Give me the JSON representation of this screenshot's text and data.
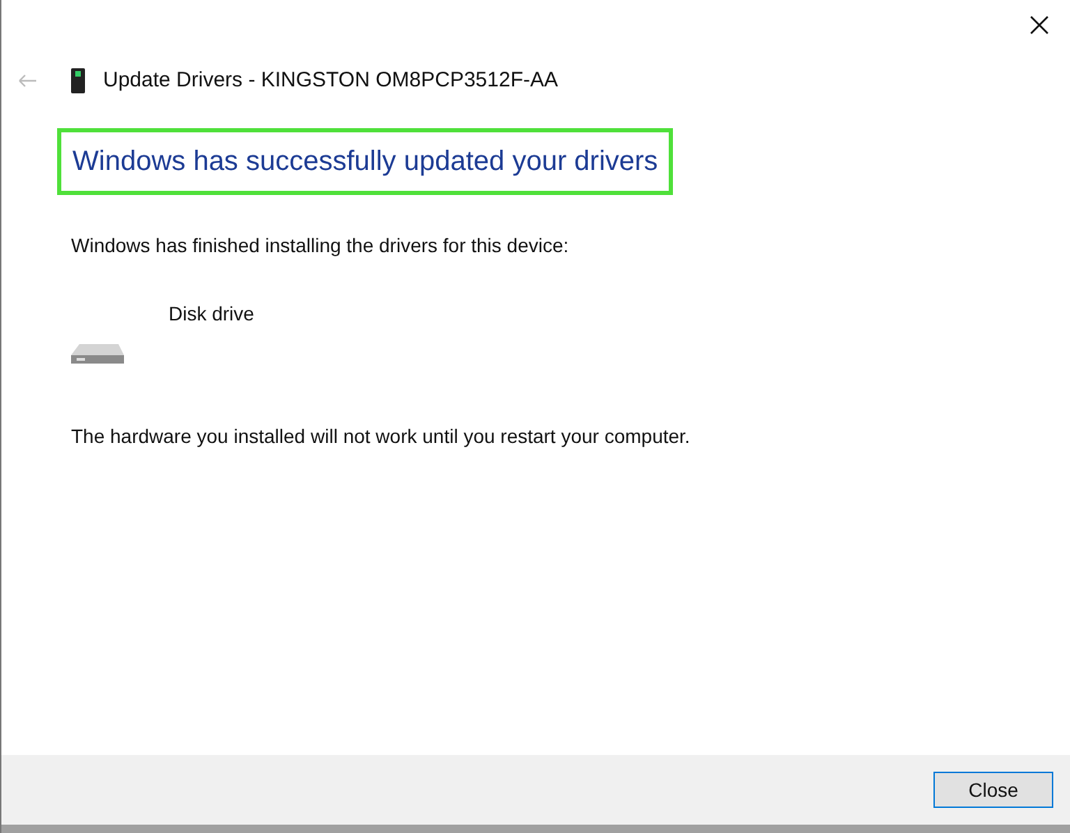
{
  "window": {
    "title": "Update Drivers - KINGSTON OM8PCP3512F-AA"
  },
  "heading": {
    "text": "Windows has successfully updated your drivers",
    "highlighted": true
  },
  "message": "Windows has finished installing the drivers for this device:",
  "device": {
    "name": "Disk drive"
  },
  "note": "The hardware you installed will not work until you restart your computer.",
  "buttons": [
    {
      "label": "Close",
      "selected": true
    }
  ]
}
